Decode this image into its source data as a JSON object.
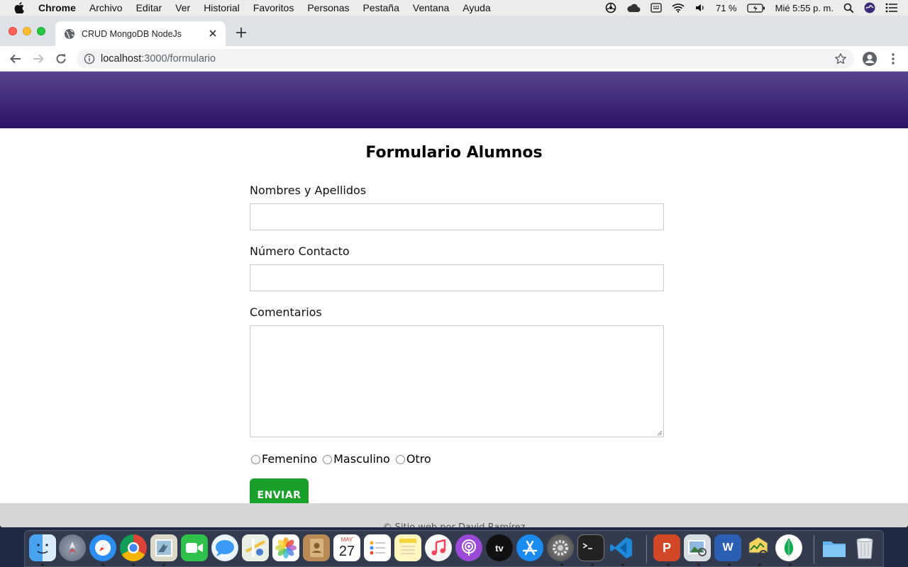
{
  "menubar": {
    "app_name": "Chrome",
    "menus": [
      "Archivo",
      "Editar",
      "Ver",
      "Historial",
      "Favoritos",
      "Personas",
      "Pestaña",
      "Ventana",
      "Ayuda"
    ],
    "battery": "71 %",
    "clock": "Mié 5:55 p. m."
  },
  "browser": {
    "tab_title": "CRUD MongoDB NodeJs",
    "url_host": "localhost",
    "url_path": ":3000/formulario"
  },
  "form": {
    "title": "Formulario Alumnos",
    "name_label": "Nombres y Apellidos",
    "name_value": "",
    "phone_label": "Número Contacto",
    "phone_value": "",
    "comments_label": "Comentarios",
    "comments_value": "",
    "gender_options": [
      "Femenino",
      "Masculino",
      "Otro"
    ],
    "submit_label": "ENVIAR"
  },
  "footer": {
    "text": "© Sitio web por David Ramírez"
  },
  "dock": {
    "apps": [
      "finder",
      "launchpad",
      "safari",
      "chrome",
      "mail",
      "facetime",
      "messages",
      "maps",
      "photos",
      "contacts",
      "calendar",
      "reminders",
      "notes",
      "music",
      "podcasts",
      "tv",
      "app-store",
      "system-preferences",
      "terminal",
      "vscode",
      "powerpoint",
      "preview",
      "word",
      "activity",
      "mongodb",
      "folder",
      "trash"
    ],
    "calendar_month": "MAY",
    "calendar_day": "27",
    "tv_label": "tv"
  }
}
